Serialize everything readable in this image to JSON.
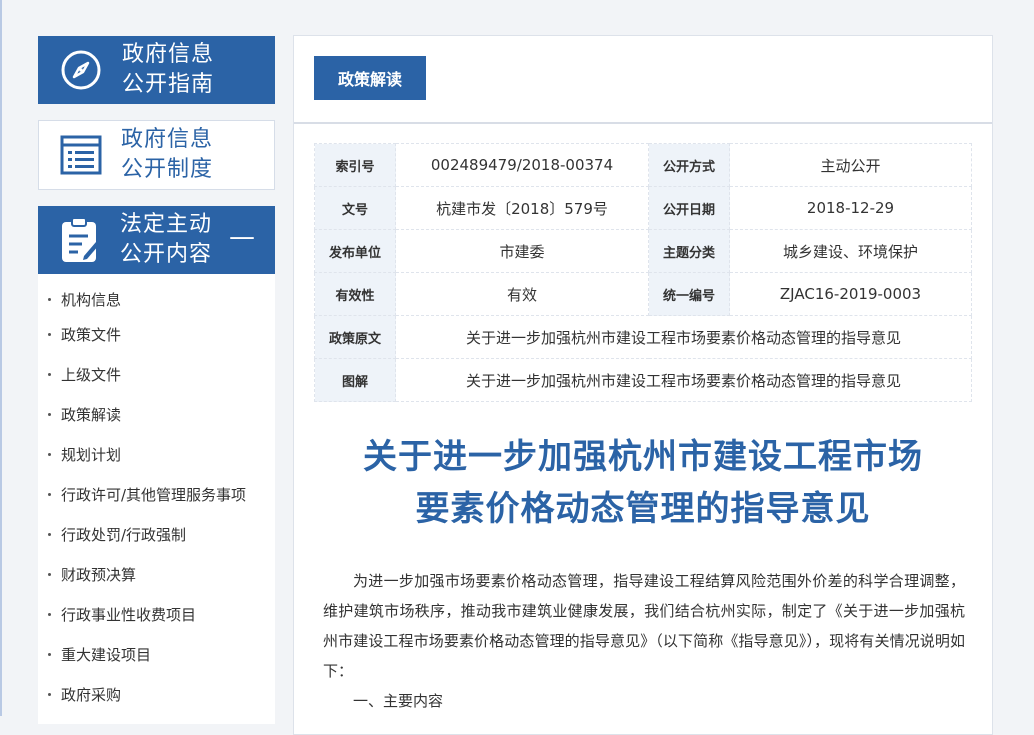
{
  "sidebar": {
    "guide": {
      "line1": "政府信息",
      "line2": "公开指南"
    },
    "system": {
      "line1": "政府信息",
      "line2": "公开制度"
    },
    "active": {
      "line1": "法定主动",
      "line2": "公开内容",
      "toggle": "—"
    },
    "menu": [
      "机构信息",
      "政策文件",
      "上级文件",
      "政策解读",
      "规划计划",
      "行政许可/其他管理服务事项",
      "行政处罚/行政强制",
      "财政预决算",
      "行政事业性收费项目",
      "重大建设项目",
      "政府采购"
    ]
  },
  "tab_label": "政策解读",
  "info": {
    "index_label": "索引号",
    "index_value": "002489479/2018-00374",
    "method_label": "公开方式",
    "method_value": "主动公开",
    "doc_label": "文号",
    "doc_value": "杭建市发〔2018〕579号",
    "date_label": "公开日期",
    "date_value": "2018-12-29",
    "unit_label": "发布单位",
    "unit_value": "市建委",
    "topic_label": "主题分类",
    "topic_value": "城乡建设、环境保护",
    "valid_label": "有效性",
    "valid_value": "有效",
    "serial_label": "统一编号",
    "serial_value": "ZJAC16-2019-0003",
    "orig_label": "政策原文",
    "orig_value": "关于进一步加强杭州市建设工程市场要素价格动态管理的指导意见",
    "graph_label": "图解",
    "graph_value": "关于进一步加强杭州市建设工程市场要素价格动态管理的指导意见"
  },
  "article": {
    "title_line1": "关于进一步加强杭州市建设工程市场",
    "title_line2": "要素价格动态管理的指导意见",
    "para1": "为进一步加强市场要素价格动态管理，指导建设工程结算风险范围外价差的科学合理调整，维护建筑市场秩序，推动我市建筑业健康发展，我们结合杭州实际，制定了《关于进一步加强杭州市建设工程市场要素价格动态管理的指导意见》（以下简称《指导意见》），现将有关情况说明如下：",
    "para2": "一、主要内容"
  },
  "colors": {
    "brand": "#2b63a6",
    "label_bg": "#eef3f9"
  }
}
